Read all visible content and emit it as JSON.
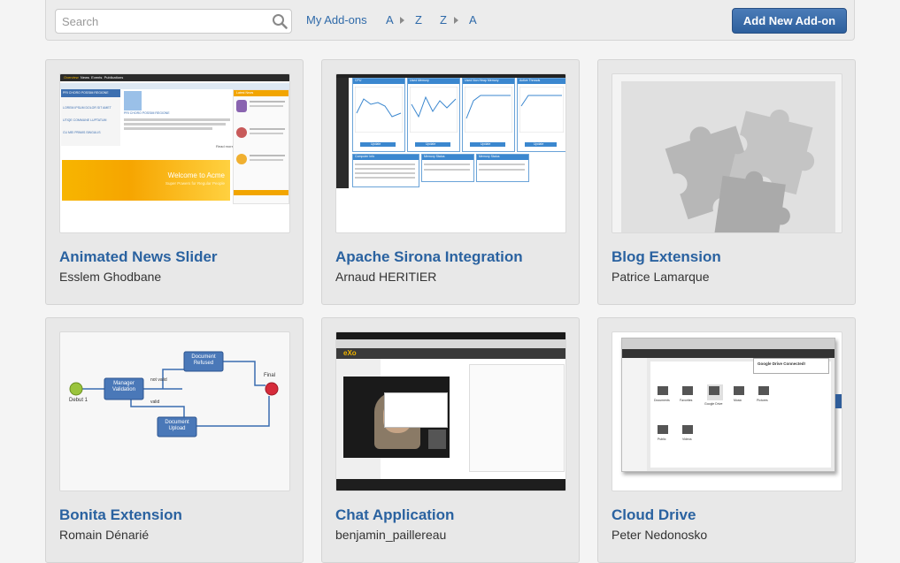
{
  "toolbar": {
    "search_placeholder": "Search",
    "my_addons": "My Add-ons",
    "sort_az_from": "A",
    "sort_az_to": "Z",
    "sort_za_from": "Z",
    "sort_za_to": "A",
    "add_button": "Add New Add-on"
  },
  "cards": [
    {
      "title": "Animated News Slider",
      "author": "Esslem Ghodbane",
      "thumb": {
        "nav": [
          "Overview",
          "News",
          "Events",
          "Publications"
        ],
        "side_links": [
          "PRI CHORO POSSIM REGIONE",
          "LOREM IPSUM DOLOR SIT AMET",
          "UTIQE COMMUNE LUPTATUM",
          "CU MEI PRIMIS SINGULIS"
        ],
        "article_title": "PRI CHORO POSSIM REGIONE",
        "banner_title": "Welcome to Acme",
        "banner_sub": "Super Powers for Regular People",
        "panel_title": "Latest News",
        "read_more": "Read more"
      }
    },
    {
      "title": "Apache Sirona Integration",
      "author": "Arnaud HERITIER",
      "thumb": {
        "panels": [
          "CPU",
          "Used Memory",
          "Used Non Heap Memory",
          "Active Threads"
        ],
        "info_panels": [
          "Computer Info",
          "Memory Status",
          "Memory Status"
        ],
        "button": "Update"
      }
    },
    {
      "title": "Blog Extension",
      "author": "Patrice Lamarque",
      "thumb": {}
    },
    {
      "title": "Bonita Extension",
      "author": "Romain Dénarié",
      "thumb": {
        "start": "Debut 1",
        "task1": "Manager Validation",
        "task2": "Document Refused",
        "task3": "Document Upload",
        "end": "Final",
        "not_valid": "not valid",
        "valid": "valid"
      }
    },
    {
      "title": "Chat Application",
      "author": "benjamin_paillereau",
      "thumb": {
        "logo": "eXo"
      }
    },
    {
      "title": "Cloud Drive",
      "author": "Peter Nedonosko",
      "thumb": {
        "notice": "Google Drive Connected!",
        "folders": [
          "Documents",
          "Favorites",
          "Google Drive",
          "Music",
          "Pictures",
          "Public",
          "Videos"
        ]
      }
    }
  ]
}
